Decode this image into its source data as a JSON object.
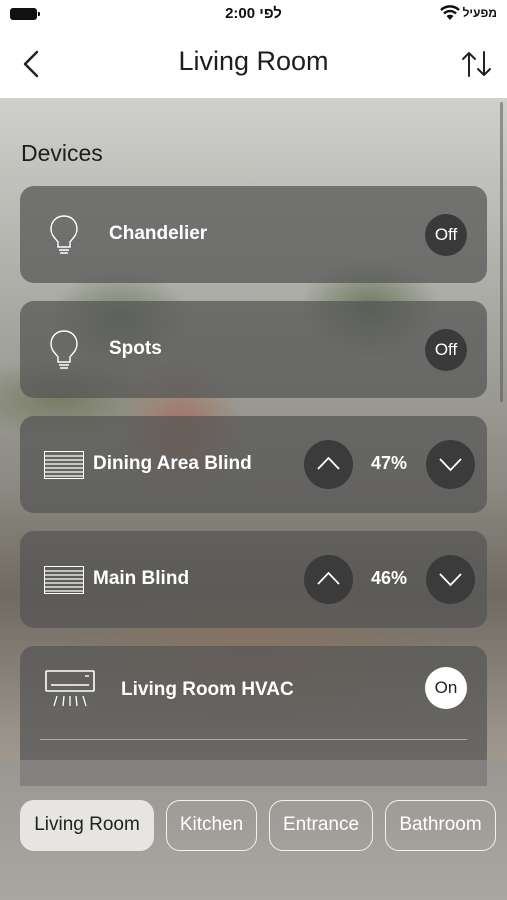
{
  "status": {
    "time": "2:00 לפי",
    "carrier": "מפעיל"
  },
  "nav": {
    "title": "Living Room"
  },
  "section": {
    "title": "Devices"
  },
  "devices": [
    {
      "name": "Chandelier",
      "state": "Off",
      "icon": "lightbulb-icon"
    },
    {
      "name": "Spots",
      "state": "Off",
      "icon": "lightbulb-icon"
    },
    {
      "name": "Dining Area Blind",
      "position": "47%",
      "icon": "blind-icon"
    },
    {
      "name": "Main Blind",
      "position": "46%",
      "icon": "blind-icon"
    },
    {
      "name": "Living Room HVAC",
      "state": "On",
      "icon": "air-conditioner-icon"
    }
  ],
  "rooms": [
    "Living Room",
    "Kitchen",
    "Entrance",
    "Bathroom"
  ],
  "active_room": "Living Room"
}
